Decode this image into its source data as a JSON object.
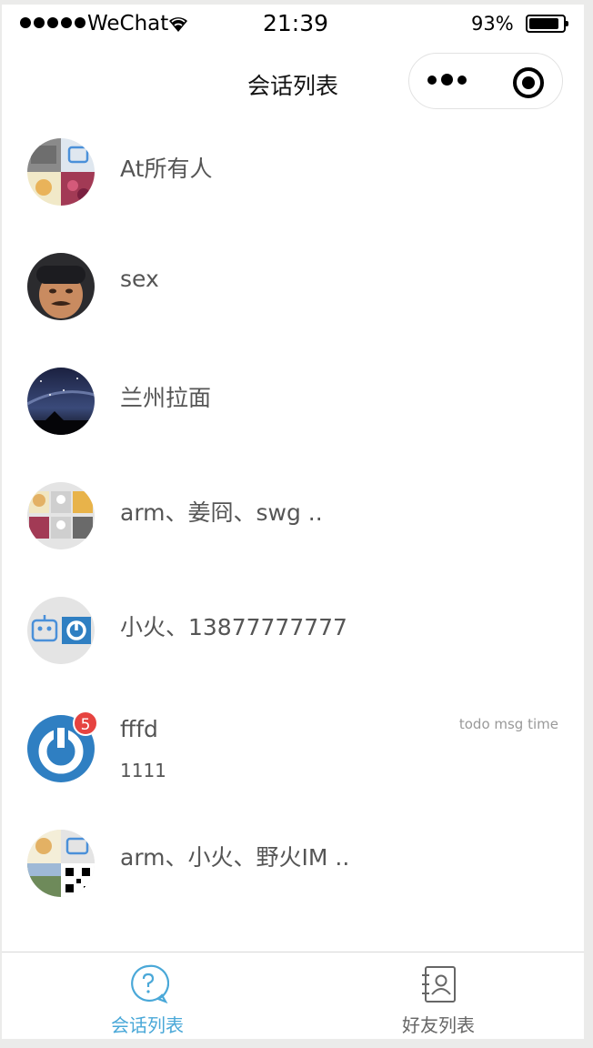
{
  "status_bar": {
    "carrier": "WeChat",
    "time": "21:39",
    "battery_percent": "93%",
    "battery_level": 0.93
  },
  "nav": {
    "title": "会话列表",
    "capsule_more_icon": "more-dots-icon",
    "capsule_close_icon": "target-circle-icon"
  },
  "conversations": [
    {
      "name": "At所有人",
      "avatar": "group-collage"
    },
    {
      "name": "sex",
      "avatar": "person-photo"
    },
    {
      "name": "兰州拉面",
      "avatar": "night-sky-photo"
    },
    {
      "name": "arm、姜冏、swg ..",
      "avatar": "group-collage"
    },
    {
      "name": "小火、13877777777",
      "avatar": "robot-power-collage"
    },
    {
      "name": "fffd",
      "avatar": "power-logo",
      "time": "todo msg time",
      "last_msg": "1111",
      "unread": "5"
    },
    {
      "name": "arm、小火、野火IM ..",
      "avatar": "group-collage"
    }
  ],
  "tab_bar": {
    "tabs": [
      {
        "label": "会话列表",
        "icon": "chat-question-icon",
        "active": true
      },
      {
        "label": "好友列表",
        "icon": "contacts-book-icon",
        "active": false
      }
    ]
  },
  "colors": {
    "accent": "#4aa8d8",
    "badge": "#e64340",
    "text": "#555555",
    "muted": "#999999"
  }
}
